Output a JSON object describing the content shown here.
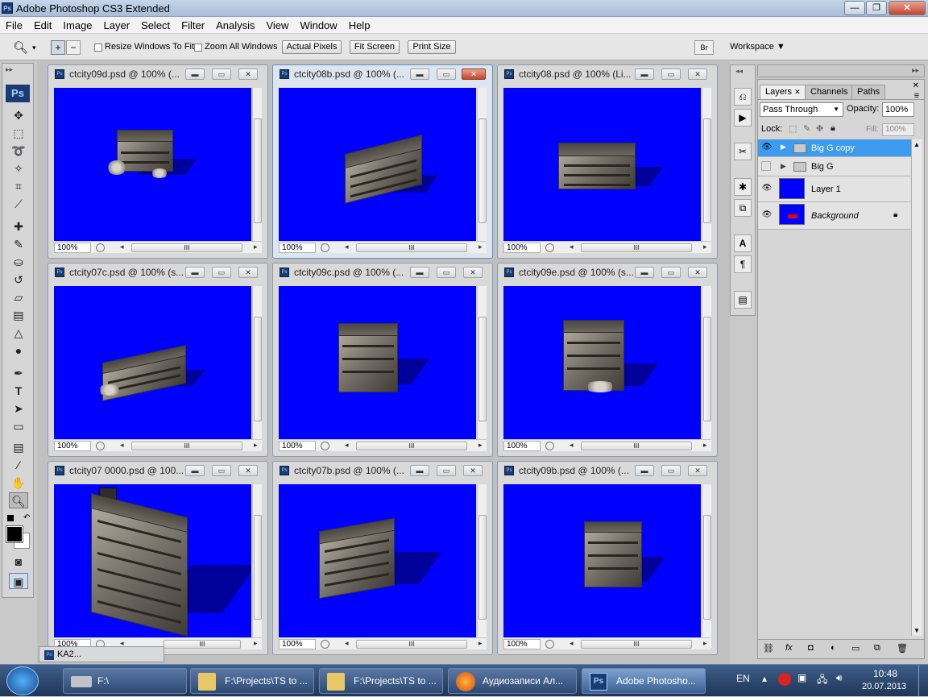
{
  "app": {
    "title": "Adobe Photoshop CS3 Extended",
    "logo": "Ps"
  },
  "window_controls": {
    "minimize": "—",
    "maximize": "❐",
    "close": "✕"
  },
  "menu": [
    "File",
    "Edit",
    "Image",
    "Layer",
    "Select",
    "Filter",
    "Analysis",
    "View",
    "Window",
    "Help"
  ],
  "options": {
    "resize_windows_label": "Resize Windows To Fit",
    "zoom_all_label": "Zoom All Windows",
    "actual_pixels": "Actual Pixels",
    "fit_screen": "Fit Screen",
    "print_size": "Print Size",
    "workspace": "Workspace ▼"
  },
  "documents": [
    {
      "name": "ctcity09d.psd @ 100% (...",
      "zoom": "100%"
    },
    {
      "name": "ctcity08b.psd @ 100% (...",
      "zoom": "100%"
    },
    {
      "name": "ctcity08.psd @ 100% (Li...",
      "zoom": "100%"
    },
    {
      "name": "ctcity07c.psd @ 100% (s...",
      "zoom": "100%"
    },
    {
      "name": "ctcity09c.psd @ 100% (...",
      "zoom": "100%"
    },
    {
      "name": "ctcity09e.psd @ 100% (s...",
      "zoom": "100%"
    },
    {
      "name": "ctcity07 0000.psd @ 100...",
      "zoom": "100%"
    },
    {
      "name": "ctcity07b.psd @ 100% (...",
      "zoom": "100%"
    },
    {
      "name": "ctcity09b.psd @ 100% (...",
      "zoom": "100%"
    }
  ],
  "minimized_doc": {
    "name": "KA2..."
  },
  "layers_panel": {
    "tabs": [
      "Layers",
      "Channels",
      "Paths"
    ],
    "blend_mode": "Pass Through",
    "opacity_label": "Opacity:",
    "opacity_value": "100%",
    "lock_label": "Lock:",
    "fill_label": "Fill:",
    "fill_value": "100%",
    "layers": [
      {
        "name": "Big G copy"
      },
      {
        "name": "Big G"
      },
      {
        "name": "Layer 1"
      },
      {
        "name": "Background"
      }
    ]
  },
  "taskbar": {
    "items": [
      {
        "label": "F:\\"
      },
      {
        "label": "F:\\Projects\\TS to ..."
      },
      {
        "label": "F:\\Projects\\TS to ..."
      },
      {
        "label": "Аудиозаписи Ал..."
      },
      {
        "label": "Adobe Photosho..."
      }
    ],
    "lang": "EN",
    "time": "10:48",
    "date": "20.07.2013"
  },
  "colors": {
    "canvas": "#0000ff",
    "selection": "#3d9bf0"
  }
}
